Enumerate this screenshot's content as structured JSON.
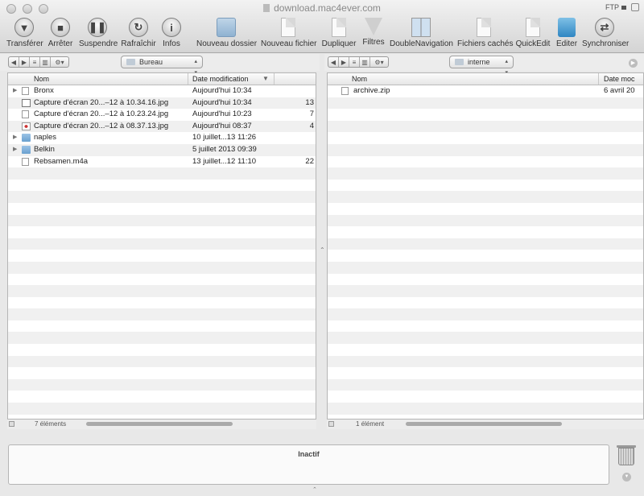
{
  "window": {
    "title": "download.mac4ever.com",
    "connection": "FTP"
  },
  "toolbar": {
    "items": [
      {
        "label": "Transférer",
        "icon": "transfer-icon"
      },
      {
        "label": "Arrêter",
        "icon": "stop-icon"
      },
      {
        "label": "Suspendre",
        "icon": "pause-icon"
      },
      {
        "label": "Rafraîchir",
        "icon": "refresh-icon"
      },
      {
        "label": "Infos",
        "icon": "info-icon"
      },
      {
        "label": "Nouveau dossier",
        "icon": "new-folder-icon"
      },
      {
        "label": "Nouveau fichier",
        "icon": "new-file-icon"
      },
      {
        "label": "Dupliquer",
        "icon": "duplicate-icon"
      },
      {
        "label": "Filtres",
        "icon": "filter-icon"
      },
      {
        "label": "DoubleNavigation",
        "icon": "double-navigation-icon"
      },
      {
        "label": "Fichiers cachés",
        "icon": "hidden-files-icon"
      },
      {
        "label": "QuickEdit",
        "icon": "quickedit-icon"
      },
      {
        "label": "Editer",
        "icon": "edit-icon"
      },
      {
        "label": "Synchroniser",
        "icon": "sync-icon"
      }
    ]
  },
  "left_pane": {
    "location": "Bureau",
    "columns": {
      "name": "Nom",
      "date": "Date modification"
    },
    "files": [
      {
        "name": "Bronx",
        "date": "Aujourd'hui 10:34",
        "size": "",
        "kind": "file-icon"
      },
      {
        "name": "Capture d'écran 20...–12 à 10.34.16.jpg",
        "date": "Aujourd'hui 10:34",
        "size": "13",
        "kind": "image-icon"
      },
      {
        "name": "Capture d'écran 20...–12 à 10.23.24.jpg",
        "date": "Aujourd'hui 10:23",
        "size": "7",
        "kind": "image-icon"
      },
      {
        "name": "Capture d'écran 20...–12 à 08.37.13.jpg",
        "date": "Aujourd'hui 08:37",
        "size": "4",
        "kind": "image-icon"
      },
      {
        "name": "naples",
        "date": "10 juillet...13 11:26",
        "size": "",
        "kind": "folder-icon"
      },
      {
        "name": "Belkin",
        "date": "5 juillet 2013 09:39",
        "size": "",
        "kind": "folder-icon"
      },
      {
        "name": "Rebsamen.m4a",
        "date": "13 juillet...12 11:10",
        "size": "22",
        "kind": "audio-file-icon"
      }
    ],
    "status": "7 éléments"
  },
  "right_pane": {
    "location": "interne",
    "columns": {
      "name": "Nom",
      "date": "Date moc"
    },
    "files": [
      {
        "name": "archive.zip",
        "date": "6 avril 20",
        "kind": "zip-file-icon"
      }
    ],
    "status": "1 élément"
  },
  "activity": {
    "status": "Inactif"
  }
}
